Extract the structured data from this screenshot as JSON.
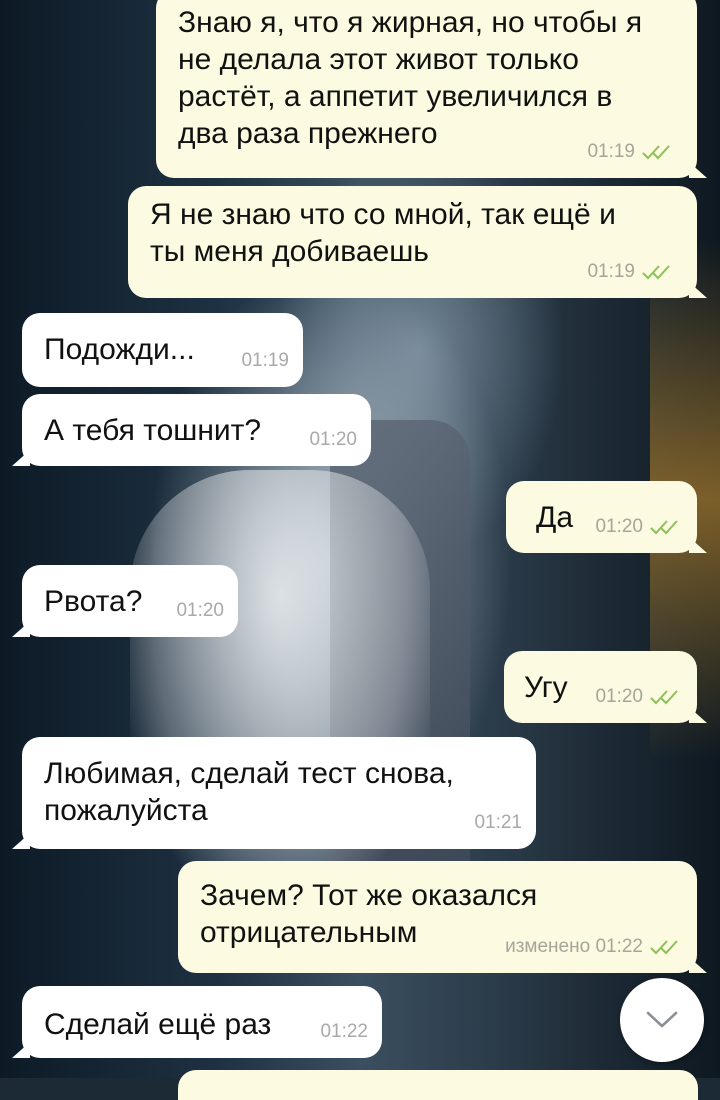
{
  "messages": [
    {
      "direction": "out",
      "text": "Знаю я, что я жирная, но чтобы я не делала этот живот только растёт, а аппетит увеличился в два раза прежнего",
      "time": "01:19",
      "read": true
    },
    {
      "direction": "out",
      "text": "Я не знаю что со мной, так ещё и ты меня добиваешь",
      "time": "01:19",
      "read": true
    },
    {
      "direction": "in",
      "text": "Подожди...",
      "time": "01:19"
    },
    {
      "direction": "in",
      "text": "А тебя тошнит?",
      "time": "01:20"
    },
    {
      "direction": "out",
      "text": "Да",
      "time": "01:20",
      "read": true
    },
    {
      "direction": "in",
      "text": "Рвота?",
      "time": "01:20"
    },
    {
      "direction": "out",
      "text": "Угу",
      "time": "01:20",
      "read": true
    },
    {
      "direction": "in",
      "text": "Любимая, сделай тест снова, пожалуйста",
      "time": "01:21"
    },
    {
      "direction": "out",
      "text": "Зачем? Тот же оказался отрицательным",
      "time": "изменено 01:22",
      "read": true
    },
    {
      "direction": "in",
      "text": "Сделай ещё раз",
      "time": "01:22"
    }
  ],
  "icons": {
    "read_receipt": "double-check-icon",
    "scroll_down": "chevron-down-icon"
  },
  "colors": {
    "incoming_bubble": "#ffffff",
    "outgoing_bubble": "#fcfae0",
    "read_check": "#8fbf5a",
    "timestamp": "#a7a59a"
  }
}
